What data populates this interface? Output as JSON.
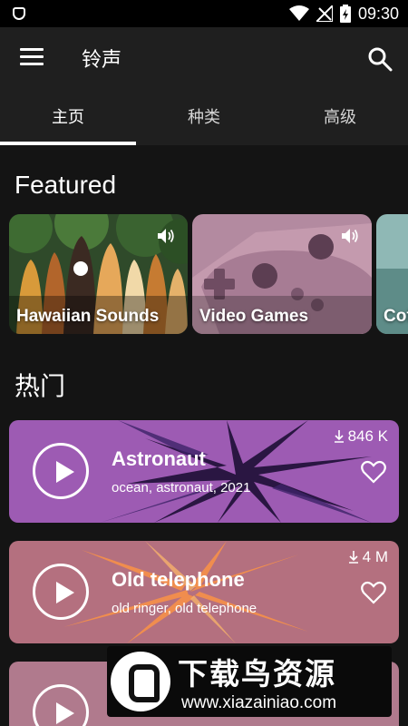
{
  "status_bar": {
    "time": "09:30",
    "icons": [
      "shield-icon",
      "wifi-icon",
      "signal-icon",
      "battery-icon"
    ]
  },
  "app_bar": {
    "title": "铃声"
  },
  "tabs": [
    {
      "label": "主页",
      "active": true
    },
    {
      "label": "种类",
      "active": false
    },
    {
      "label": "高级",
      "active": false
    }
  ],
  "featured": {
    "title": "Featured",
    "items": [
      {
        "label": "Hawaiian Sounds"
      },
      {
        "label": "Video Games"
      },
      {
        "label": "Cof"
      }
    ]
  },
  "popular": {
    "title": "热门",
    "items": [
      {
        "name": "Astronaut",
        "tags": "ocean, astronaut, 2021",
        "downloads": "846 K"
      },
      {
        "name": "Old telephone",
        "tags": "old ringer, old telephone",
        "downloads": "4 M"
      },
      {
        "name": "",
        "tags": "",
        "downloads": ""
      }
    ]
  },
  "watermark": {
    "title": "下载鸟资源",
    "url": "www.xiazainiao.com"
  },
  "colors": {
    "background": "#141414",
    "app_bar": "#1f1f1f",
    "card_purple": "#a05ab5",
    "card_pink": "#b4707f"
  }
}
